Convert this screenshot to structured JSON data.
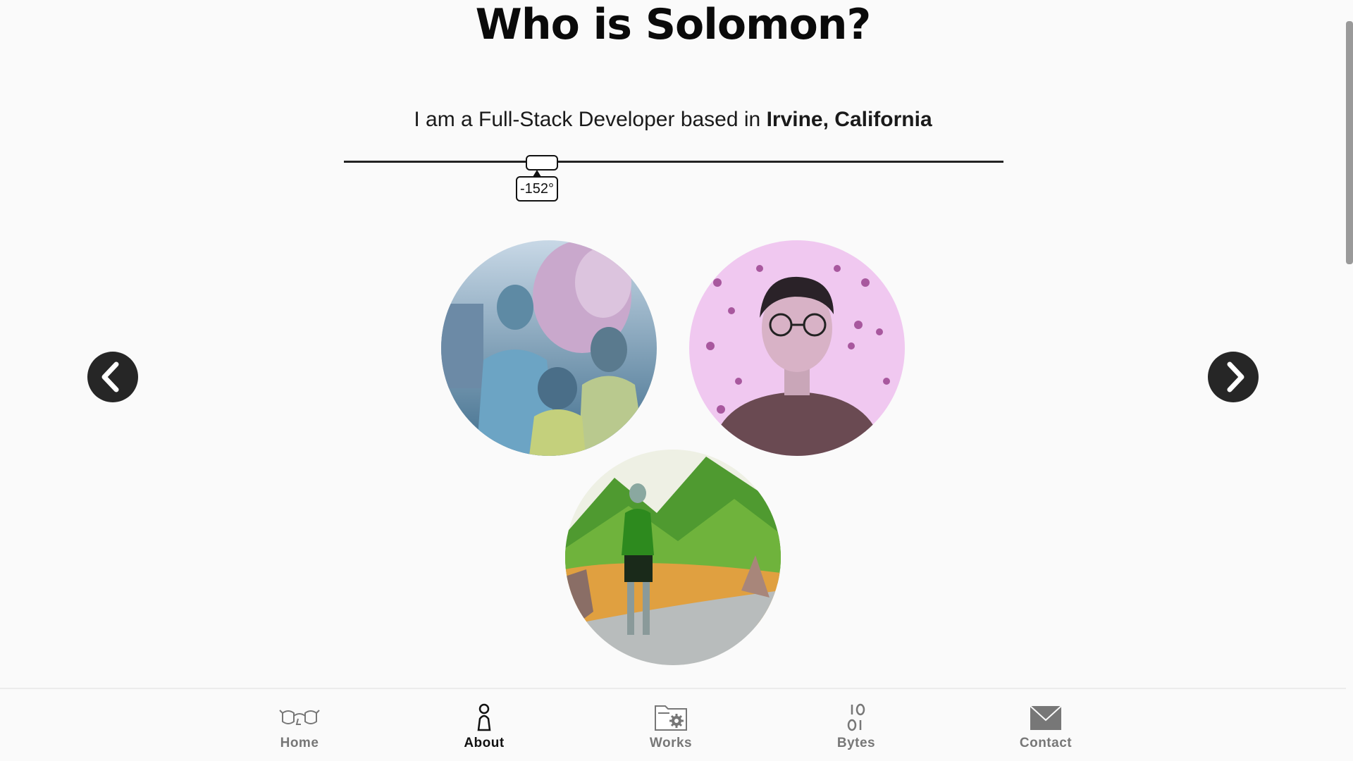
{
  "header": {
    "title": "Who is Solomon?",
    "intro_text": "I am a Full-Stack Developer based in ",
    "location": "Irvine, California"
  },
  "rotation_slider": {
    "value_label": "-152°",
    "value_degrees": -152
  },
  "carousel": {
    "prev_icon": "chevron-left-icon",
    "next_icon": "chevron-right-icon",
    "photos": [
      "family-photo",
      "portrait-photo",
      "hiking-photo"
    ]
  },
  "bottom_nav": {
    "items": [
      {
        "label": "Home",
        "icon": "glasses-icon",
        "active": false
      },
      {
        "label": "About",
        "icon": "person-icon",
        "active": true
      },
      {
        "label": "Works",
        "icon": "folder-gear-icon",
        "active": false
      },
      {
        "label": "Bytes",
        "icon": "binary-icon",
        "active": false
      },
      {
        "label": "Contact",
        "icon": "envelope-icon",
        "active": false
      }
    ]
  },
  "colors": {
    "background": "#fafafa",
    "text": "#111111",
    "nav_inactive": "#777777",
    "arrow_bg": "#262626"
  }
}
